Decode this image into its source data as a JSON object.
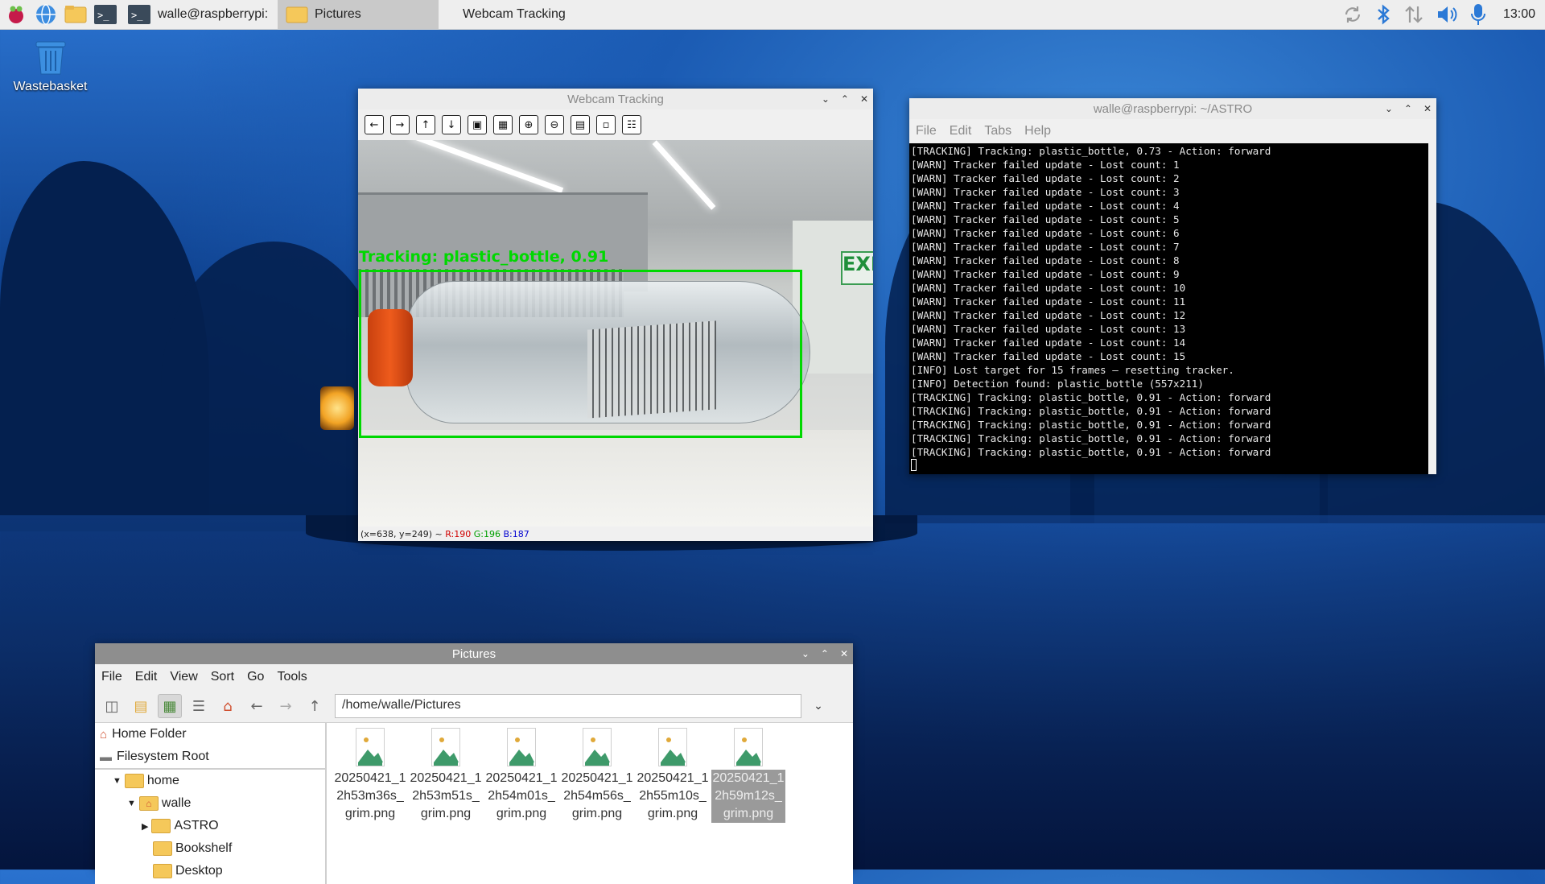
{
  "taskbar": {
    "tasks": [
      {
        "label": "walle@raspberrypi: ..."
      },
      {
        "label": "Pictures"
      },
      {
        "label": "Webcam Tracking"
      }
    ],
    "clock": "13:00"
  },
  "desktop": {
    "wastebasket_label": "Wastebasket"
  },
  "webcam": {
    "title": "Webcam Tracking",
    "overlay_label": "Tracking: plastic_bottle, 0.91",
    "status": {
      "coords": "(x=638, y=249) ~",
      "r": "R:190",
      "g": "G:196",
      "b": "B:187"
    },
    "colors": {
      "box": "#00d800",
      "r": "#d00000",
      "g": "#00a000",
      "b": "#0000d0"
    }
  },
  "terminal": {
    "title": "walle@raspberrypi: ~/ASTRO",
    "menu": [
      "File",
      "Edit",
      "Tabs",
      "Help"
    ],
    "lines": [
      "[TRACKING] Tracking: plastic_bottle, 0.73 - Action: forward",
      "[WARN] Tracker failed update - Lost count: 1",
      "[WARN] Tracker failed update - Lost count: 2",
      "[WARN] Tracker failed update - Lost count: 3",
      "[WARN] Tracker failed update - Lost count: 4",
      "[WARN] Tracker failed update - Lost count: 5",
      "[WARN] Tracker failed update - Lost count: 6",
      "[WARN] Tracker failed update - Lost count: 7",
      "[WARN] Tracker failed update - Lost count: 8",
      "[WARN] Tracker failed update - Lost count: 9",
      "[WARN] Tracker failed update - Lost count: 10",
      "[WARN] Tracker failed update - Lost count: 11",
      "[WARN] Tracker failed update - Lost count: 12",
      "[WARN] Tracker failed update - Lost count: 13",
      "[WARN] Tracker failed update - Lost count: 14",
      "[WARN] Tracker failed update - Lost count: 15",
      "[INFO] Lost target for 15 frames — resetting tracker.",
      "[INFO] Detection found: plastic_bottle (557x211)",
      "[TRACKING] Tracking: plastic_bottle, 0.91 - Action: forward",
      "[TRACKING] Tracking: plastic_bottle, 0.91 - Action: forward",
      "[TRACKING] Tracking: plastic_bottle, 0.91 - Action: forward",
      "[TRACKING] Tracking: plastic_bottle, 0.91 - Action: forward",
      "[TRACKING] Tracking: plastic_bottle, 0.91 - Action: forward"
    ]
  },
  "filemanager": {
    "title": "Pictures",
    "menu": [
      "File",
      "Edit",
      "View",
      "Sort",
      "Go",
      "Tools"
    ],
    "path": "/home/walle/Pictures",
    "places": [
      "Home Folder",
      "Filesystem Root"
    ],
    "tree": [
      "home",
      "walle",
      "ASTRO",
      "Bookshelf",
      "Desktop"
    ],
    "files": [
      [
        "20250421_1",
        "2h53m36s_",
        "grim.png"
      ],
      [
        "20250421_1",
        "2h53m51s_",
        "grim.png"
      ],
      [
        "20250421_1",
        "2h54m01s_",
        "grim.png"
      ],
      [
        "20250421_1",
        "2h54m56s_",
        "grim.png"
      ],
      [
        "20250421_1",
        "2h55m10s_",
        "grim.png"
      ],
      [
        "20250421_1",
        "2h59m12s_",
        "grim.png"
      ]
    ]
  }
}
